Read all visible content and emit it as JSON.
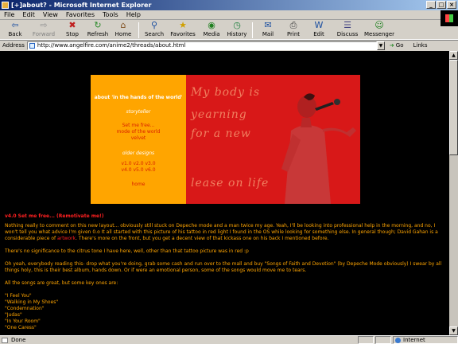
{
  "window": {
    "title": "[+]about? - Microsoft Internet Explorer"
  },
  "menu": [
    "File",
    "Edit",
    "View",
    "Favorites",
    "Tools",
    "Help"
  ],
  "toolbar": {
    "back": "Back",
    "forward": "Forward",
    "stop": "Stop",
    "refresh": "Refresh",
    "home": "Home",
    "search": "Search",
    "favorites": "Favorites",
    "media": "Media",
    "history": "History",
    "mail": "Mail",
    "print": "Print",
    "edit": "Edit",
    "discuss": "Discuss",
    "messenger": "Messenger"
  },
  "address": {
    "label": "Address",
    "url": "http://www.angelfire.com/anime2/threads/about.html",
    "go": "Go",
    "links": "Links"
  },
  "nav": {
    "title": "about 'in the hands of the world'",
    "storyteller": "storyteller",
    "set_free": "Set me free...",
    "mode": "mode of the world",
    "velvet": "velvet",
    "designs": "older designs",
    "versions1": "v1.0  v2.0  v3.0",
    "versions2": "v4.0  v5.0  v6.0",
    "home": "home"
  },
  "banner_text": {
    "line1": "My body is",
    "line2": "yearning",
    "line3": "for a new",
    "line4": "lease on life"
  },
  "content": {
    "heading": "v4.0 Set me free... (Remotivate me!)",
    "p1a": "Nothing really to comment on this new layout... obviously still stuck on Depeche mode and a man twice my age. Yeah, I'll be looking into professional help in the morning, and no, I won't tell you what advice I'm given 0.o It all started with this picture of his tattoo in red light I found in the OS while looking for something else. In general though; David Gahan is a considerable piece of ",
    "p1link": "artwork",
    "p1b": ". There's more on the front, but you get a decent view of that kickass one on his back I mentioned before.",
    "p2": "There's no significance to the citrus tone I have here, well, other than that tattoo picture was in red :p",
    "p3": "Oh yeah, everybody reading this- drop what you're doing, grab some cash and run over to the mall and buy \"Songs of Faith and Devotion\" (by Depeche Mode obviously) I swear by all things holy, this is their best album, hands down. Or if were an emotional person, some of the songs would move me to tears.",
    "p4": "All the songs are great, but some key ones are:",
    "songs": [
      "\"I Feel You\"",
      "\"Walking in My Shoes\"",
      "\"Condemnation\"",
      "\"Judas\"",
      "\"In Your Room\"",
      "\"One Caress\""
    ]
  },
  "status": {
    "text": "Done",
    "zone": "Internet"
  },
  "colors": {
    "page_bg": "#000000",
    "text": "#ffa500",
    "accent": "#ff2020",
    "nav_bg": "#ffa500",
    "photo_bg": "#d81818"
  }
}
